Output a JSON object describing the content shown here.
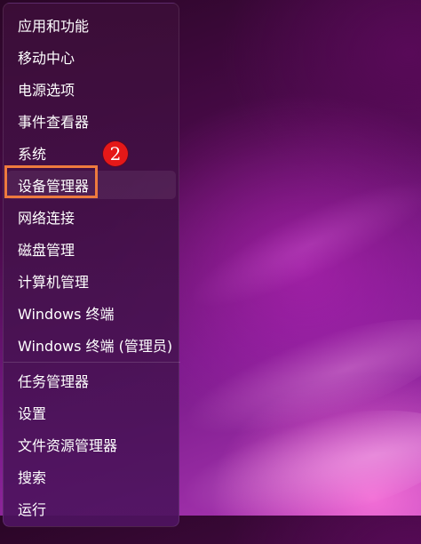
{
  "menu": {
    "items": [
      {
        "label": "应用和功能"
      },
      {
        "label": "移动中心"
      },
      {
        "label": "电源选项"
      },
      {
        "label": "事件查看器"
      },
      {
        "label": "系统"
      },
      {
        "label": "设备管理器"
      },
      {
        "label": "网络连接"
      },
      {
        "label": "磁盘管理"
      },
      {
        "label": "计算机管理"
      },
      {
        "label": "Windows 终端"
      },
      {
        "label": "Windows 终端 (管理员)"
      },
      {
        "label": "任务管理器"
      },
      {
        "label": "设置"
      },
      {
        "label": "文件资源管理器"
      },
      {
        "label": "搜索"
      },
      {
        "label": "运行"
      }
    ]
  },
  "annotation": {
    "step_badge": "2",
    "badge_color": "#e51818",
    "highlight_color": "#ee7a3e"
  }
}
